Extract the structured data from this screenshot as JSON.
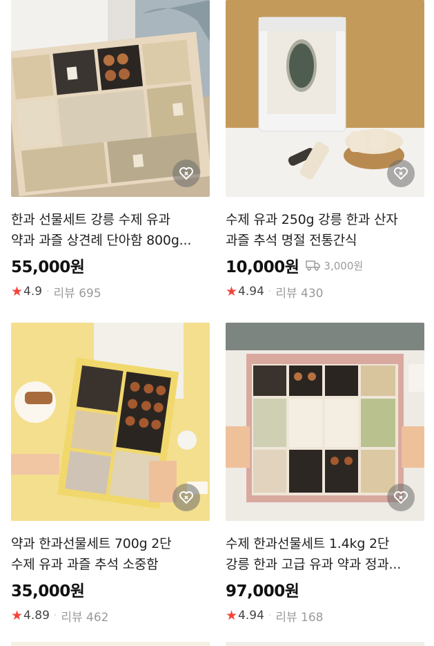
{
  "products": [
    {
      "title_line1": "한과 선물세트 강릉 수제 유과",
      "title_line2": "약과 과즐 상견례 단아함 800g...",
      "price": "55,000원",
      "shipping": "",
      "rating": "4.9",
      "review_label": "리뷰 695",
      "image_icon": "hangwa-gift-box-photo"
    },
    {
      "title_line1": "수제 유과 250g 강릉 한과 산자",
      "title_line2": "과즐 추석 명절 전통간식",
      "price": "10,000원",
      "shipping": "3,000원",
      "rating": "4.94",
      "review_label": "리뷰 430",
      "image_icon": "yugwa-pouch-photo"
    },
    {
      "title_line1": "약과 한과선물세트 700g 2단",
      "title_line2": "수제 유과 과즐 추석 소중함",
      "price": "35,000원",
      "shipping": "",
      "rating": "4.89",
      "review_label": "리뷰 462",
      "image_icon": "yakgwa-box-photo"
    },
    {
      "title_line1": "수제 한과선물세트 1.4kg 2단",
      "title_line2": "강릉 한과 고급 유과 약과 정과...",
      "price": "97,000원",
      "shipping": "",
      "rating": "4.94",
      "review_label": "리뷰 168",
      "image_icon": "premium-hangwa-box-photo"
    }
  ],
  "colors": {
    "star": "#f5443b",
    "muted": "#9a9a9a"
  }
}
